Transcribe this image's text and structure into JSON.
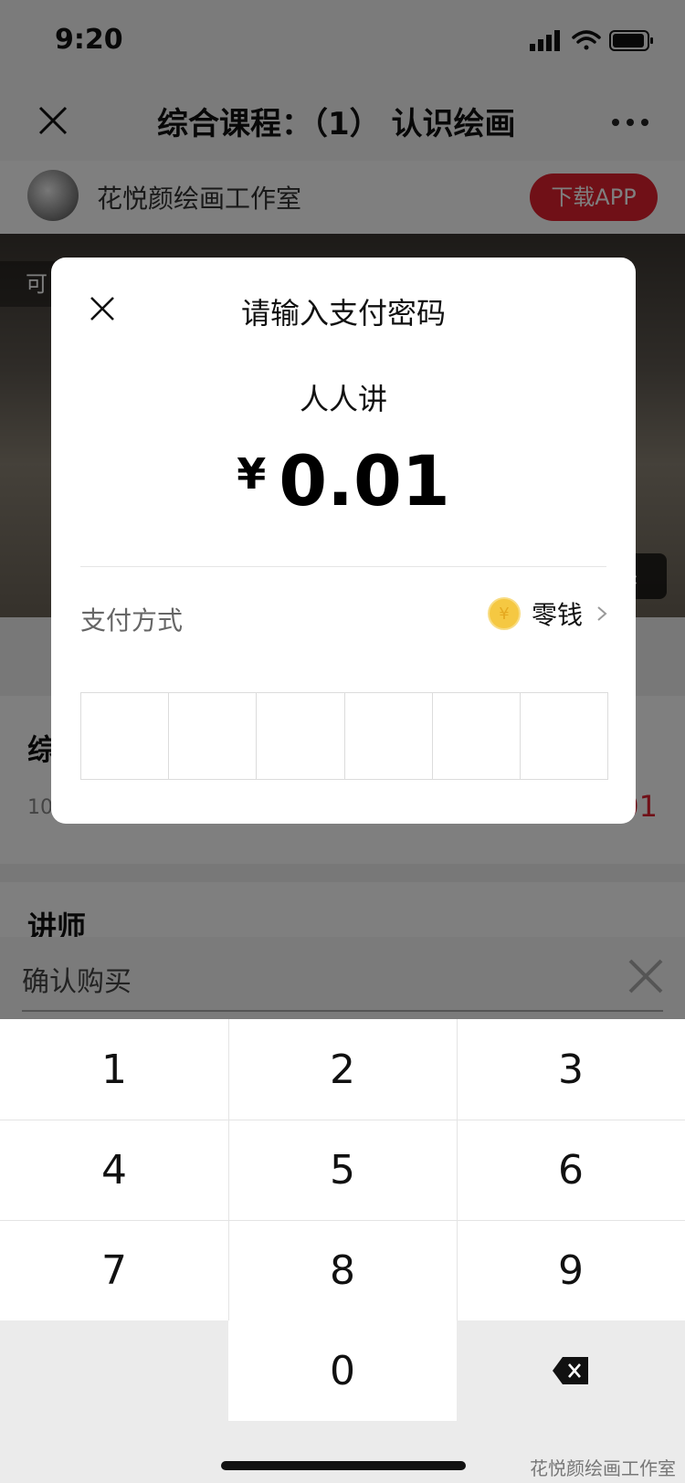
{
  "status_bar": {
    "time": "9:20"
  },
  "nav": {
    "title": "综合课程：（1） 认识绘画"
  },
  "shop": {
    "name": "花悦颜绘画工作室",
    "download_label": "下载APP"
  },
  "video": {
    "hint": "可",
    "tag": "课"
  },
  "course": {
    "title_fragment": "综",
    "meta_fragment": "10",
    "price_fragment": "01"
  },
  "teacher": {
    "label": "讲师"
  },
  "payment_dialog": {
    "title": "请输入支付密码",
    "merchant": "人人讲",
    "currency_symbol": "¥",
    "amount": "0.01",
    "method_label": "支付方式",
    "method_name": "零钱",
    "method_icon": "coin-icon",
    "pin_length": 6
  },
  "confirm_bar": {
    "label": "确认购买"
  },
  "keypad": {
    "keys": [
      "1",
      "2",
      "3",
      "4",
      "5",
      "6",
      "7",
      "8",
      "9",
      "",
      "0",
      "delete"
    ]
  },
  "watermark": "花悦颜绘画工作室",
  "colors": {
    "accent_red": "#e0212e",
    "coin_yellow": "#f5c842"
  }
}
